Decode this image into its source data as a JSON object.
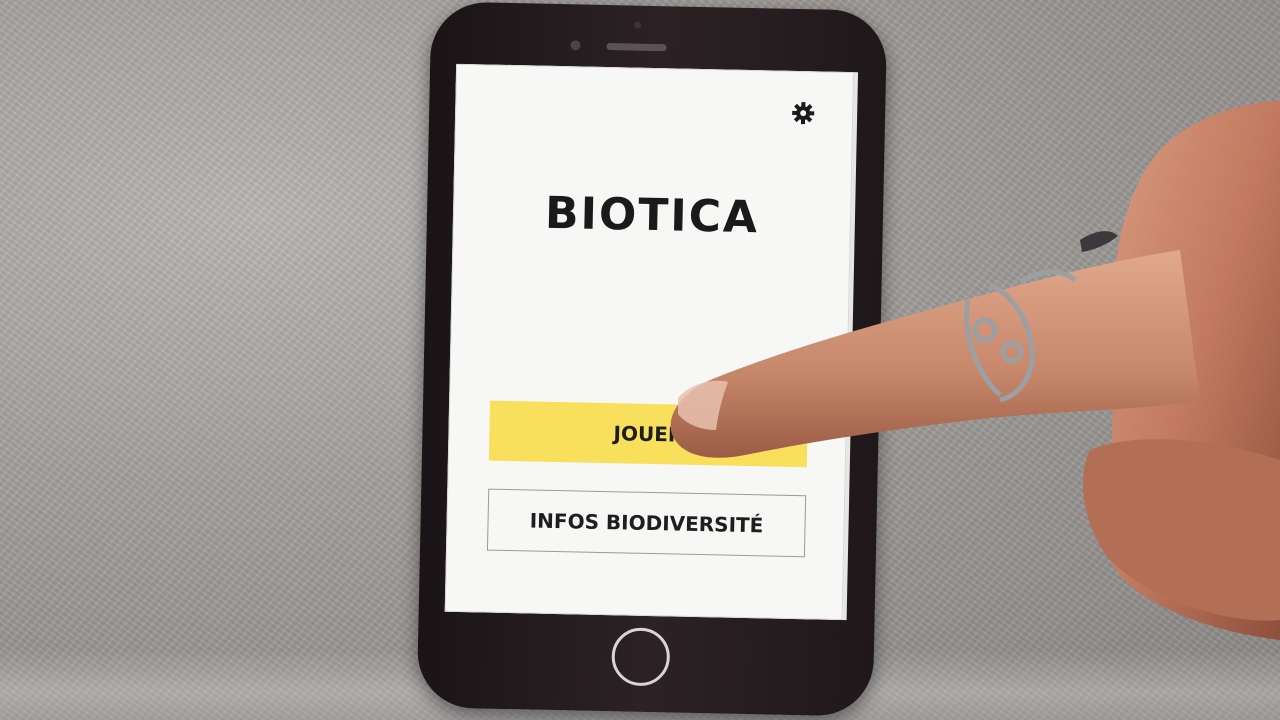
{
  "app": {
    "title": "BIOTICA"
  },
  "buttons": {
    "play_label": "JOUER",
    "info_label": "INFOS BIODIVERSITÉ"
  },
  "icons": {
    "settings": "gear-icon"
  },
  "colors": {
    "play_button": "#f8e05c",
    "screen_background": "#f7f7f6",
    "phone_body": "#221a1d",
    "title_text": "#1a1a1a"
  }
}
